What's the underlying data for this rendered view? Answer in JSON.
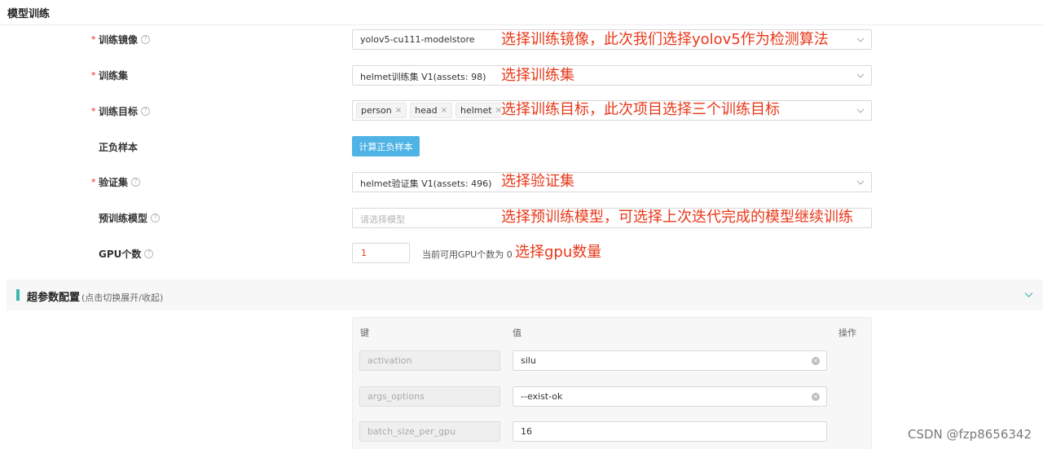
{
  "page": {
    "title": "模型训练"
  },
  "form": {
    "training_image": {
      "label": "训练镜像",
      "value": "yolov5-cu111-modelstore",
      "annotation": "选择训练镜像，此次我们选择yolov5作为检测算法"
    },
    "training_set": {
      "label": "训练集",
      "value": "helmet训练集 V1(assets: 98)",
      "annotation": "选择训练集"
    },
    "training_targets": {
      "label": "训练目标",
      "tags": [
        "person",
        "head",
        "helmet"
      ],
      "tag_close": "×",
      "annotation": "选择训练目标，此次项目选择三个训练目标"
    },
    "pos_neg_samples": {
      "label": "正负样本",
      "button_label": "计算正负样本"
    },
    "validation_set": {
      "label": "验证集",
      "value": "helmet验证集 V1(assets: 496)",
      "annotation": "选择验证集"
    },
    "pretrained_model": {
      "label": "预训练模型",
      "placeholder": "请选择模型",
      "annotation": "选择预训练模型，可选择上次迭代完成的模型继续训练"
    },
    "gpu_count": {
      "label": "GPU个数",
      "value": "1",
      "hint": "当前可用GPU个数为 0",
      "annotation": "选择gpu数量"
    },
    "required_mark": "*",
    "help_glyph": "?"
  },
  "hyperparams": {
    "title": "超参数配置",
    "subtitle": "(点击切换展开/收起)",
    "columns": {
      "key": "键",
      "value": "值",
      "action": "操作"
    },
    "rows": [
      {
        "key": "activation",
        "value": "silu",
        "clearable": true
      },
      {
        "key": "args_options",
        "value": "--exist-ok",
        "clearable": true
      },
      {
        "key": "batch_size_per_gpu",
        "value": "16",
        "clearable": false
      }
    ],
    "clear_glyph": "×"
  },
  "watermark": "CSDN @fzp8656342",
  "colors": {
    "annotation": "#e8381a",
    "primary_button": "#4fb3e6",
    "section_accent": "#3fb5b0",
    "required": "#f5222d"
  },
  "icons": {
    "help": "question-circle-icon",
    "dropdown": "chevron-down-icon",
    "clear": "close-circle-icon",
    "section_toggle": "chevron-down-icon"
  }
}
